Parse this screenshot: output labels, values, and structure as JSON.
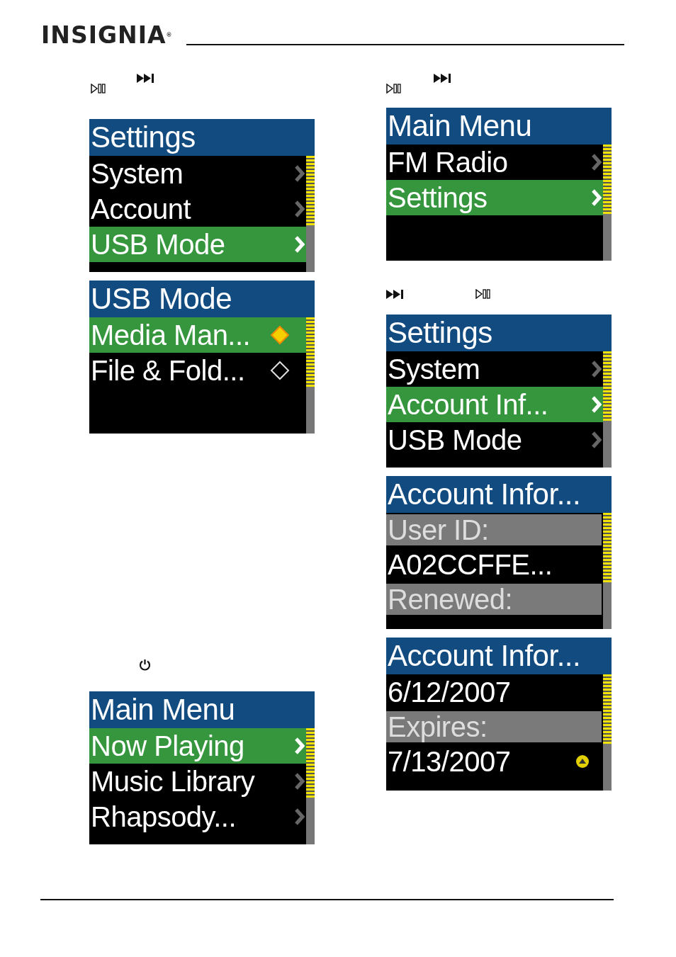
{
  "header": {
    "logo": "INSIGNIA",
    "logo_mark": "®"
  },
  "columns": [
    {
      "items": [
        {
          "kind": "icons",
          "icons": [
            {
              "kind": "next"
            },
            {
              "kind": "play_pause"
            }
          ]
        },
        {
          "kind": "screen",
          "title": "Settings",
          "rows": [
            {
              "kind": "menu",
              "label": "System",
              "selected": false
            },
            {
              "kind": "menu",
              "label": "Account",
              "selected": false
            },
            {
              "kind": "menu",
              "label": "USB Mode",
              "selected": true
            }
          ]
        },
        {
          "kind": "screen",
          "title": "USB Mode",
          "rows": [
            {
              "kind": "option",
              "label": "Media Man...",
              "selected": true,
              "checked": true
            },
            {
              "kind": "option",
              "label": "File & Fold...",
              "selected": false,
              "checked": false
            }
          ]
        },
        {
          "kind": "icons",
          "icons": [
            {
              "kind": "power"
            }
          ]
        },
        {
          "kind": "screen",
          "title": "Main Menu",
          "rows": [
            {
              "kind": "menu",
              "label": "Now Playing",
              "selected": true
            },
            {
              "kind": "menu",
              "label": "Music Library",
              "selected": false
            },
            {
              "kind": "menu",
              "label": "Rhapsody...",
              "selected": false
            }
          ]
        }
      ]
    },
    {
      "items": [
        {
          "kind": "icons",
          "icons": [
            {
              "kind": "next"
            },
            {
              "kind": "play_pause"
            }
          ]
        },
        {
          "kind": "screen",
          "title": "Main Menu",
          "rows": [
            {
              "kind": "menu",
              "label": "FM Radio",
              "selected": false
            },
            {
              "kind": "menu",
              "label": "Settings",
              "selected": true
            }
          ]
        },
        {
          "kind": "icons",
          "icons": [
            {
              "kind": "next"
            },
            {
              "kind": "play_pause"
            }
          ]
        },
        {
          "kind": "screen",
          "title": "Settings",
          "rows": [
            {
              "kind": "menu",
              "label": "System",
              "selected": false
            },
            {
              "kind": "menu",
              "label": "Account Inf...",
              "selected": true
            },
            {
              "kind": "menu",
              "label": "USB Mode",
              "selected": false
            }
          ]
        },
        {
          "kind": "screen",
          "title": "Account Infor...",
          "rows": [
            {
              "kind": "field",
              "label": "User ID:"
            },
            {
              "kind": "value",
              "label": "A02CCFFE..."
            },
            {
              "kind": "field",
              "label": "Renewed:"
            }
          ]
        },
        {
          "kind": "screen",
          "title": "Account Infor...",
          "rows": [
            {
              "kind": "value",
              "label": "6/12/2007"
            },
            {
              "kind": "field",
              "label": "Expires:"
            },
            {
              "kind": "value",
              "label": "7/13/2007",
              "indicator": true
            }
          ]
        }
      ]
    }
  ]
}
